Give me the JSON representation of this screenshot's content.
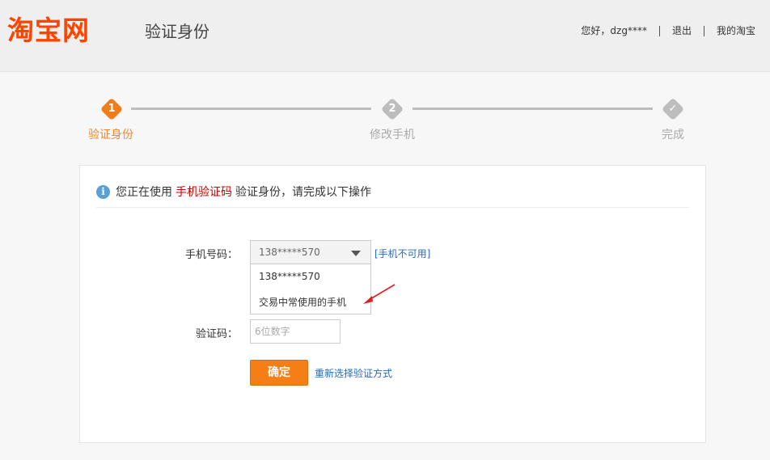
{
  "header": {
    "logo": "淘宝网",
    "title": "验证身份",
    "greeting": "您好，dzg****",
    "logout": "退出",
    "my_taobao": "我的淘宝"
  },
  "steps": [
    {
      "num": "1",
      "label": "验证身份",
      "state": "active"
    },
    {
      "num": "2",
      "label": "修改手机",
      "state": "pending"
    },
    {
      "num": "✓",
      "label": "完成",
      "state": "pending"
    }
  ],
  "colors": {
    "brand": "#ff4400",
    "step_active": "#f07d1a",
    "step_inactive": "#bdbdbd",
    "button": "#f47f16",
    "link": "#2a6ab8",
    "highlight": "#cc0000"
  },
  "notice": {
    "icon": "info-icon",
    "prefix": "您正在使用",
    "highlight": "手机验证码",
    "suffix": "验证身份，请完成以下操作"
  },
  "form": {
    "phone_label": "手机号码：",
    "phone_selected": "138*****570",
    "phone_unavailable": "[手机不可用]",
    "dropdown_options": [
      "138*****570",
      "交易中常使用的手机"
    ],
    "code_label": "验证码：",
    "code_placeholder": "6位数字",
    "confirm": "确定",
    "reselect": "重新选择验证方式"
  }
}
